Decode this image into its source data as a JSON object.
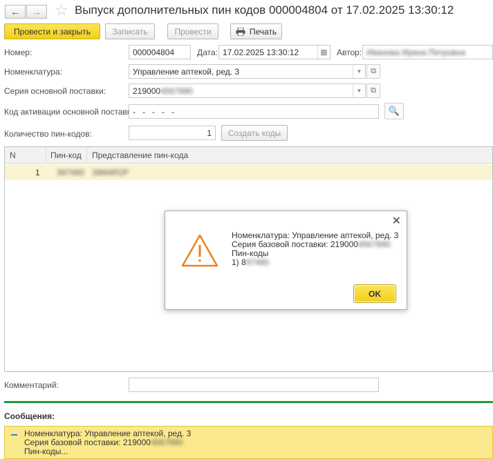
{
  "window": {
    "title": "Выпуск дополнительных пин кодов 000004804 от 17.02.2025 13:30:12"
  },
  "toolbar": {
    "post_close_label": "Провести и закрыть",
    "save_label": "Записать",
    "post_label": "Провести",
    "print_label": "Печать"
  },
  "form": {
    "number_label": "Номер:",
    "number_value": "000004804",
    "date_label": "Дата:",
    "date_value": "17.02.2025 13:30:12",
    "author_label": "Автор:",
    "author_value": "Иванова Ирина Петровна",
    "nomenclature_label": "Номенклатура:",
    "nomenclature_value": "Управление аптекой, ред. 3",
    "series_label": "Серия основной поставки:",
    "series_value_visible": "219000",
    "series_value_hidden": "4567890",
    "activation_label": "Код активации основной поставки:",
    "activation_value": "-   -   -   -   -",
    "count_label": "Количество пин-кодов:",
    "count_value": "1",
    "create_codes_label": "Создать коды",
    "comment_label": "Комментарий:",
    "comment_value": ""
  },
  "table": {
    "columns": [
      "N",
      "Пин-код",
      "Представление пин-кода"
    ],
    "rows": [
      {
        "n": "1",
        "pin": "397480",
        "repr": "39M4R2P"
      }
    ]
  },
  "dialog": {
    "line1": "Номенклатура: Управление аптекой, ред. 3",
    "line2_visible": "Серия базовой поставки: 219000",
    "line2_hidden": "4567890",
    "line3": "Пин-коды",
    "line4_visible": "1) 8",
    "line4_hidden": "97480",
    "ok_label": "OK"
  },
  "messages": {
    "header": "Сообщения:",
    "line1": "Номенклатура: Управление аптекой, ред. 3",
    "line2_visible": "Серия базовой поставки: 219000",
    "line2_hidden": "4567890",
    "line3": "Пин-коды..."
  },
  "colors": {
    "accent_yellow": "#f5d321",
    "separator_green": "#1e9a3c",
    "warning_orange": "#e8821e"
  }
}
